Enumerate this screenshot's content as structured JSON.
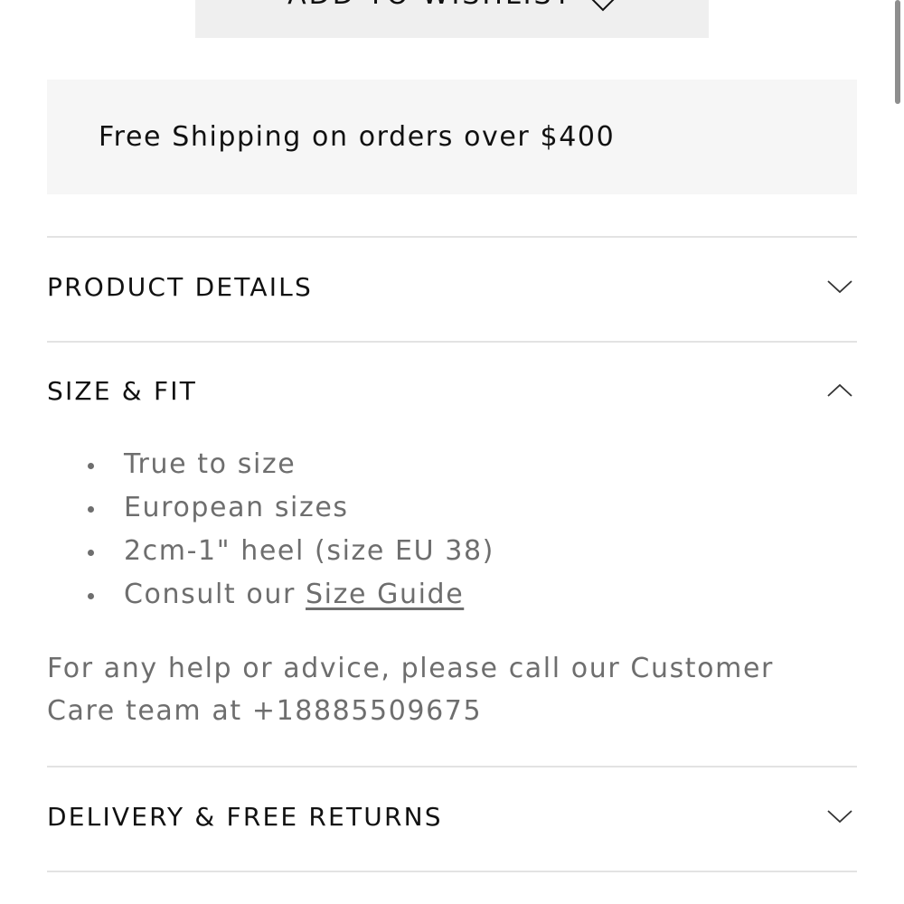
{
  "wishlist": {
    "label": "ADD TO WISHLIST",
    "icon": "heart-icon"
  },
  "shipping": {
    "text": "Free Shipping on orders over $400"
  },
  "sections": {
    "product_details": {
      "title": "PRODUCT DETAILS",
      "icon": "chevron-down-icon",
      "expanded": false
    },
    "size_fit": {
      "title": "SIZE & FIT",
      "icon": "chevron-up-icon",
      "expanded": true,
      "items": [
        "True to size",
        "European sizes",
        "2cm-1\" heel (size EU 38)"
      ],
      "consult_prefix": "Consult our ",
      "consult_link": "Size Guide",
      "help": "For any help or advice, please call our Customer Care team at +18885509675"
    },
    "delivery": {
      "title": "DELIVERY & FREE RETURNS",
      "icon": "chevron-down-icon",
      "expanded": false
    }
  },
  "colors": {
    "banner_bg": "#f6f6f6",
    "button_bg": "#efefef",
    "muted_text": "#6e6e6e",
    "divider": "#e3e3e3"
  }
}
